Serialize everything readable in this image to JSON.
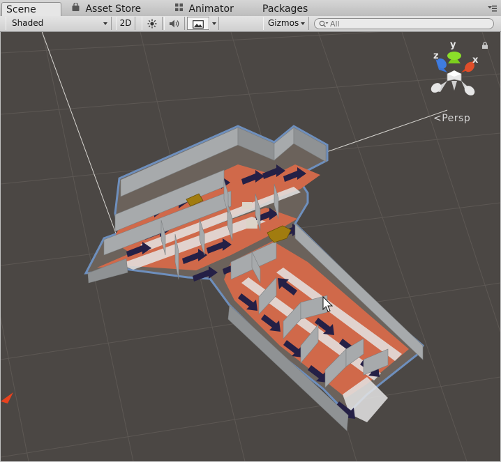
{
  "tabs": [
    {
      "label": "Scene",
      "icon": "scene-icon"
    },
    {
      "label": "Asset Store",
      "icon": "asset-store-icon"
    },
    {
      "label": "Animator",
      "icon": "animator-icon"
    },
    {
      "label": "Packages",
      "icon": ""
    }
  ],
  "toolbar": {
    "shading_mode": "Shaded",
    "mode_2d": "2D",
    "gizmos": "Gizmos",
    "search_placeholder": "All"
  },
  "viewport": {
    "projection_label": "Persp",
    "gizmo_axes": {
      "x": "x",
      "y": "y",
      "z": "z"
    },
    "colors": {
      "background": "#4b4744",
      "grid": "#5f5a56",
      "floor": "#d0694a",
      "wall": "#a4a7a9",
      "outline": "#6e8fbd",
      "arrow": "#252046",
      "gizmo_x": "#d8421f",
      "gizmo_y": "#7ccf1d",
      "gizmo_z": "#3a74d8"
    }
  }
}
